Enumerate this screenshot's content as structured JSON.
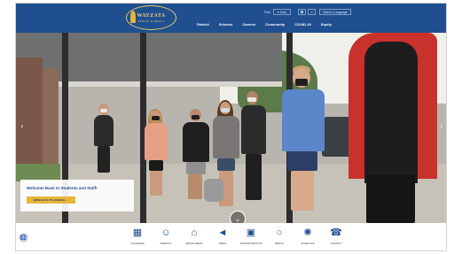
{
  "header": {
    "logo_main": "WAYZATA",
    "logo_sub": "PUBLIC SCHOOLS",
    "utility": {
      "lang_label": "Find",
      "lang_value": "▾ Jobs",
      "search_icon": "search-icon",
      "close_glyph": "×",
      "links_label": "Select a Language"
    },
    "nav": [
      "District",
      "Schools",
      "Careers",
      "Community",
      "COVID-19",
      "Equity"
    ]
  },
  "hero": {
    "welcome_text": "Welcome Back to Students and Staff!",
    "welcome_button": "VIEW BACK-TO-SCHOOL →",
    "prev_arrow": "‹",
    "next_arrow": "›",
    "scroll_glyph": "⌄"
  },
  "quick_links": {
    "accessibility_glyph": "♿",
    "items": [
      {
        "label": "CALENDAR",
        "icon": "calendar-icon",
        "glyph": "▦"
      },
      {
        "label": "PARENTS",
        "icon": "parents-icon",
        "glyph": "☺"
      },
      {
        "label": "ENROLLMENT",
        "icon": "school-icon",
        "glyph": "⌂"
      },
      {
        "label": "NEWS",
        "icon": "megaphone-icon",
        "glyph": "◄"
      },
      {
        "label": "TRANSPORTATION",
        "icon": "bus-icon",
        "glyph": "▣"
      },
      {
        "label": "MENUS",
        "icon": "apple-icon",
        "glyph": "○"
      },
      {
        "label": "ATHLETICS",
        "icon": "ball-icon",
        "glyph": "✺"
      },
      {
        "label": "CONTACT",
        "icon": "phone-icon",
        "glyph": "☎"
      }
    ]
  },
  "colors": {
    "header_blue": "#1f4f8f",
    "accent_gold": "#e8b53a"
  }
}
